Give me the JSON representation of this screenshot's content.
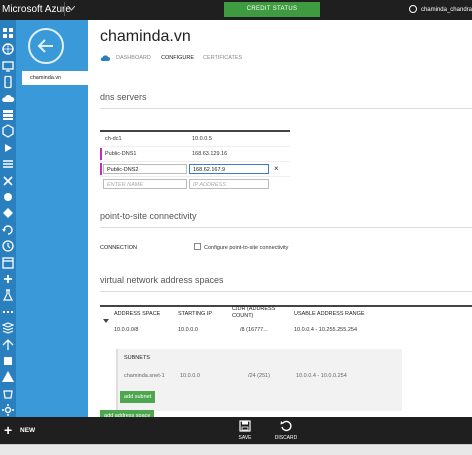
{
  "topbar": {
    "brand": "Microsoft Azure",
    "credit_status": "CREDIT STATUS",
    "user": "chaminda_chandra"
  },
  "rail": {
    "icons": [
      "all-items-icon",
      "web-sites-icon",
      "virtual-machines-icon",
      "mobile-services-icon",
      "cloud-services-icon",
      "storage-icon",
      "hdinsight-icon",
      "media-services-icon",
      "service-bus-icon",
      "visual-studio-online-icon",
      "cache-icon",
      "biztalk-icon",
      "recovery-services-icon",
      "automation-icon",
      "scheduler-icon",
      "api-management-icon",
      "machine-learning-icon",
      "stream-analytics-icon",
      "networks-icon",
      "traffic-manager-icon",
      "management-services-icon",
      "active-directory-icon",
      "marketplace-icon",
      "settings-icon"
    ]
  },
  "subnav": {
    "item": "chaminda.vn"
  },
  "page": {
    "title": "chaminda.vn",
    "tabs": [
      "DASHBOARD",
      "CONFIGURE",
      "CERTIFICATES"
    ],
    "active_tab": "CONFIGURE"
  },
  "dns": {
    "heading": "dns servers",
    "rows": [
      {
        "name": "ch-dc1",
        "ip": "10.0.0.5"
      },
      {
        "name": "Public-DNS1",
        "ip": "168.63.129.16"
      },
      {
        "name": "Public-DNS2",
        "ip": "168.62.167.9"
      }
    ],
    "name_placeholder": "ENTER NAME",
    "ip_placeholder": "IP ADDRESS"
  },
  "p2s": {
    "heading": "point-to-site connectivity",
    "label": "CONNECTION",
    "checkbox_label": "Configure point-to-site connectivity"
  },
  "vnet": {
    "heading": "virtual network address spaces",
    "columns": [
      "ADDRESS SPACE",
      "STARTING IP",
      "CIDR (ADDRESS COUNT)",
      "USABLE ADDRESS RANGE"
    ],
    "row": {
      "space": "10.0.0.0/8",
      "start": "10.0.0.0",
      "cidr": "/8 (16777...",
      "range": "10.0.0.4 - 10.255.255.254"
    },
    "subnets_label": "SUBNETS",
    "subnet": {
      "name": "chaminda.snet-1",
      "start": "10.0.0.0",
      "cidr": "/24 (251)",
      "range": "10.0.0.4 - 10.0.0.254"
    },
    "add_subnet": "add subnet",
    "add_address_space": "add address space"
  },
  "bottombar": {
    "new": "NEW",
    "save": "SAVE",
    "discard": "DISCARD"
  },
  "colors": {
    "rail": "#2a7fbf",
    "subnav": "#3a9ad9",
    "accent_green": "#4ea64e",
    "dns_marker": "#c030c0"
  }
}
